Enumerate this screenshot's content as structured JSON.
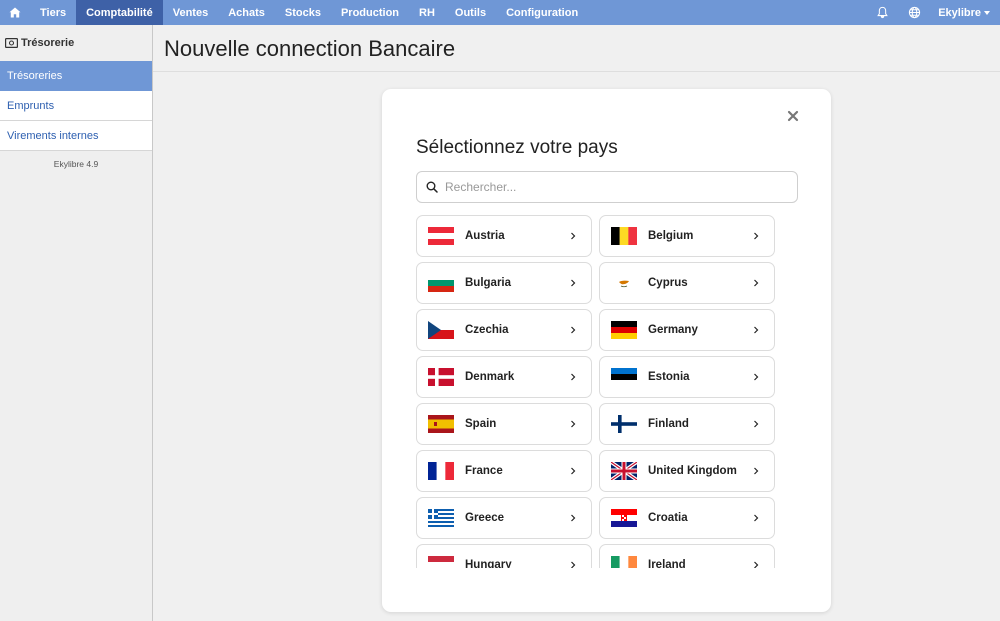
{
  "nav": {
    "items": [
      {
        "label": "Tiers",
        "active": false
      },
      {
        "label": "Comptabilité",
        "active": true
      },
      {
        "label": "Ventes",
        "active": false
      },
      {
        "label": "Achats",
        "active": false
      },
      {
        "label": "Stocks",
        "active": false
      },
      {
        "label": "Production",
        "active": false
      },
      {
        "label": "RH",
        "active": false
      },
      {
        "label": "Outils",
        "active": false
      },
      {
        "label": "Configuration",
        "active": false
      }
    ],
    "user_label": "Ekylibre"
  },
  "sidebar": {
    "heading": "Trésorerie",
    "items": [
      {
        "label": "Trésoreries",
        "active": true
      },
      {
        "label": "Emprunts",
        "active": false
      },
      {
        "label": "Virements internes",
        "active": false
      }
    ],
    "version": "Ekylibre 4.9"
  },
  "page": {
    "title": "Nouvelle connection Bancaire"
  },
  "modal": {
    "title": "Sélectionnez votre pays",
    "search_placeholder": "Rechercher...",
    "search_value": "",
    "countries": [
      {
        "name": "Austria",
        "flag": "austria-flag-icon"
      },
      {
        "name": "Belgium",
        "flag": "belgium-flag-icon"
      },
      {
        "name": "Bulgaria",
        "flag": "bulgaria-flag-icon"
      },
      {
        "name": "Cyprus",
        "flag": "cyprus-flag-icon"
      },
      {
        "name": "Czechia",
        "flag": "czechia-flag-icon"
      },
      {
        "name": "Germany",
        "flag": "germany-flag-icon"
      },
      {
        "name": "Denmark",
        "flag": "denmark-flag-icon"
      },
      {
        "name": "Estonia",
        "flag": "estonia-flag-icon"
      },
      {
        "name": "Spain",
        "flag": "spain-flag-icon"
      },
      {
        "name": "Finland",
        "flag": "finland-flag-icon"
      },
      {
        "name": "France",
        "flag": "france-flag-icon"
      },
      {
        "name": "United Kingdom",
        "flag": "united-kingdom-flag-icon"
      },
      {
        "name": "Greece",
        "flag": "greece-flag-icon"
      },
      {
        "name": "Croatia",
        "flag": "croatia-flag-icon"
      },
      {
        "name": "Hungary",
        "flag": "hungary-flag-icon"
      },
      {
        "name": "Ireland",
        "flag": "ireland-flag-icon"
      }
    ]
  },
  "icons": {
    "home": "home-icon",
    "bell": "bell-icon",
    "globe": "globe-icon",
    "treasury": "banknote-icon",
    "close": "close-icon",
    "search": "search-icon",
    "chevron": "chevron-right-icon"
  },
  "colors": {
    "nav_bg": "#6f97d6",
    "nav_active": "#3e61a7",
    "sidebar_active": "#6f97d6",
    "link": "#2d5fb0"
  }
}
